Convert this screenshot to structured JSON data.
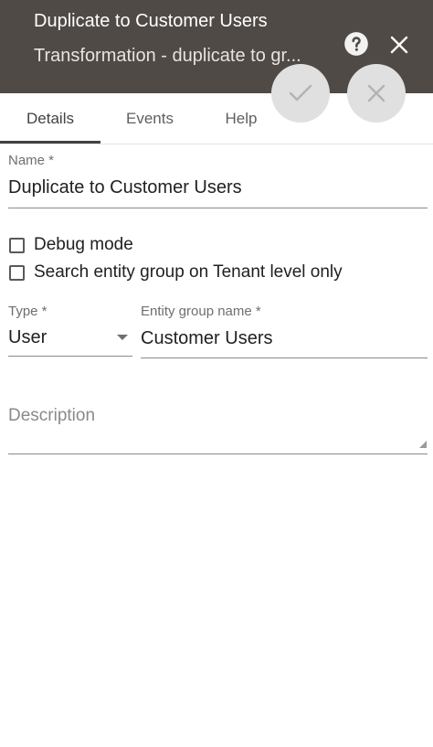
{
  "header": {
    "title": "Duplicate to Customer Users",
    "subtitle": "Transformation - duplicate to gr..."
  },
  "tabs": [
    {
      "label": "Details",
      "active": true
    },
    {
      "label": "Events",
      "active": false
    },
    {
      "label": "Help",
      "active": false
    }
  ],
  "form": {
    "name": {
      "label": "Name *",
      "value": "Duplicate to Customer Users"
    },
    "debug_mode": {
      "label": "Debug mode",
      "checked": false
    },
    "search_tenant": {
      "label": "Search entity group on Tenant level only",
      "checked": false
    },
    "type": {
      "label": "Type *",
      "value": "User"
    },
    "entity_group": {
      "label": "Entity group name *",
      "value": "Customer Users"
    },
    "description": {
      "placeholder": "Description",
      "value": ""
    }
  },
  "icons": {
    "help": "help-circle-icon",
    "close": "close-icon",
    "apply": "check-icon",
    "cancel": "close-icon"
  },
  "colors": {
    "header_bg": "#4f4a46",
    "fab_bg": "#e0e0e0",
    "active_tab": "#424242"
  }
}
